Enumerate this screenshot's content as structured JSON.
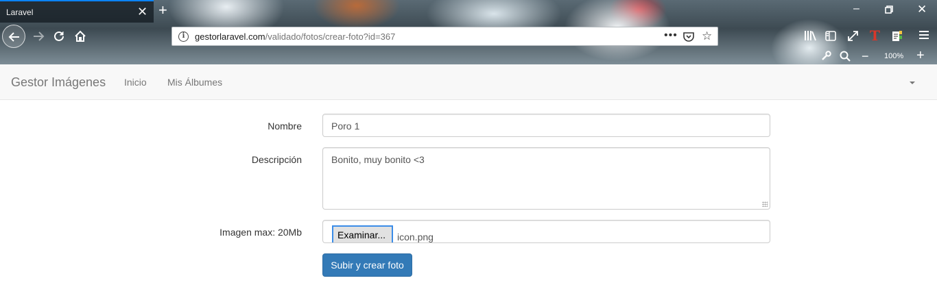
{
  "browser": {
    "tab_title": "Laravel",
    "url_host": "gestorlaravel.com",
    "url_path": "/validado/fotos/crear-foto?id=367",
    "zoom": "100%"
  },
  "navbar": {
    "brand": "Gestor Imágenes",
    "links": [
      "Inicio",
      "Mis Álbumes"
    ]
  },
  "form": {
    "name_label": "Nombre",
    "name_value": "Poro 1",
    "description_label": "Descripción",
    "description_value": "Bonito, muy bonito <3",
    "image_label": "Imagen max: 20Mb",
    "browse_label": "Examinar...",
    "file_name": "icon.png",
    "submit_label": "Subir y crear foto"
  },
  "colors": {
    "primary_button": "#337ab7",
    "navbar_bg": "#f8f8f8",
    "tab_accent": "#0a84ff"
  }
}
